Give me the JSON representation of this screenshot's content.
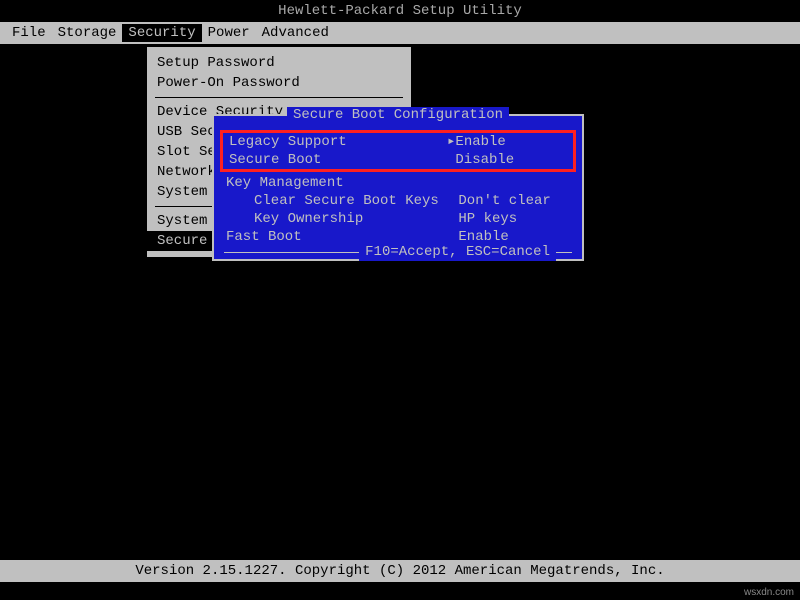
{
  "title": "Hewlett-Packard Setup Utility",
  "menu": {
    "items": [
      "File",
      "Storage",
      "Security",
      "Power",
      "Advanced"
    ],
    "selected": "Security"
  },
  "dropdown": {
    "items": [
      "Setup Password",
      "Power-On Password",
      "-",
      "Device Security",
      "USB Security",
      "Slot Security",
      "Network Boot",
      "System IDs",
      "-",
      "System Security",
      "Secure Boot Configuration"
    ],
    "selected": "Secure Boot Configuration"
  },
  "dialog": {
    "title": "Secure Boot Configuration",
    "rows": [
      {
        "label": "Legacy Support",
        "value": "Enable",
        "arrow": true,
        "highlight": true
      },
      {
        "label": "Secure Boot",
        "value": "Disable",
        "arrow": false,
        "highlight": true
      },
      {
        "label": "Key Management",
        "value": "",
        "arrow": false,
        "heading": true
      },
      {
        "label": "Clear Secure Boot Keys",
        "value": "Don't clear",
        "sub": true
      },
      {
        "label": "Key Ownership",
        "value": "HP keys",
        "sub": true
      },
      {
        "label": "Fast Boot",
        "value": "Enable"
      }
    ],
    "footer": "F10=Accept, ESC=Cancel"
  },
  "status": "Version 2.15.1227. Copyright (C) 2012 American Megatrends, Inc.",
  "watermark": "wsxdn.com"
}
